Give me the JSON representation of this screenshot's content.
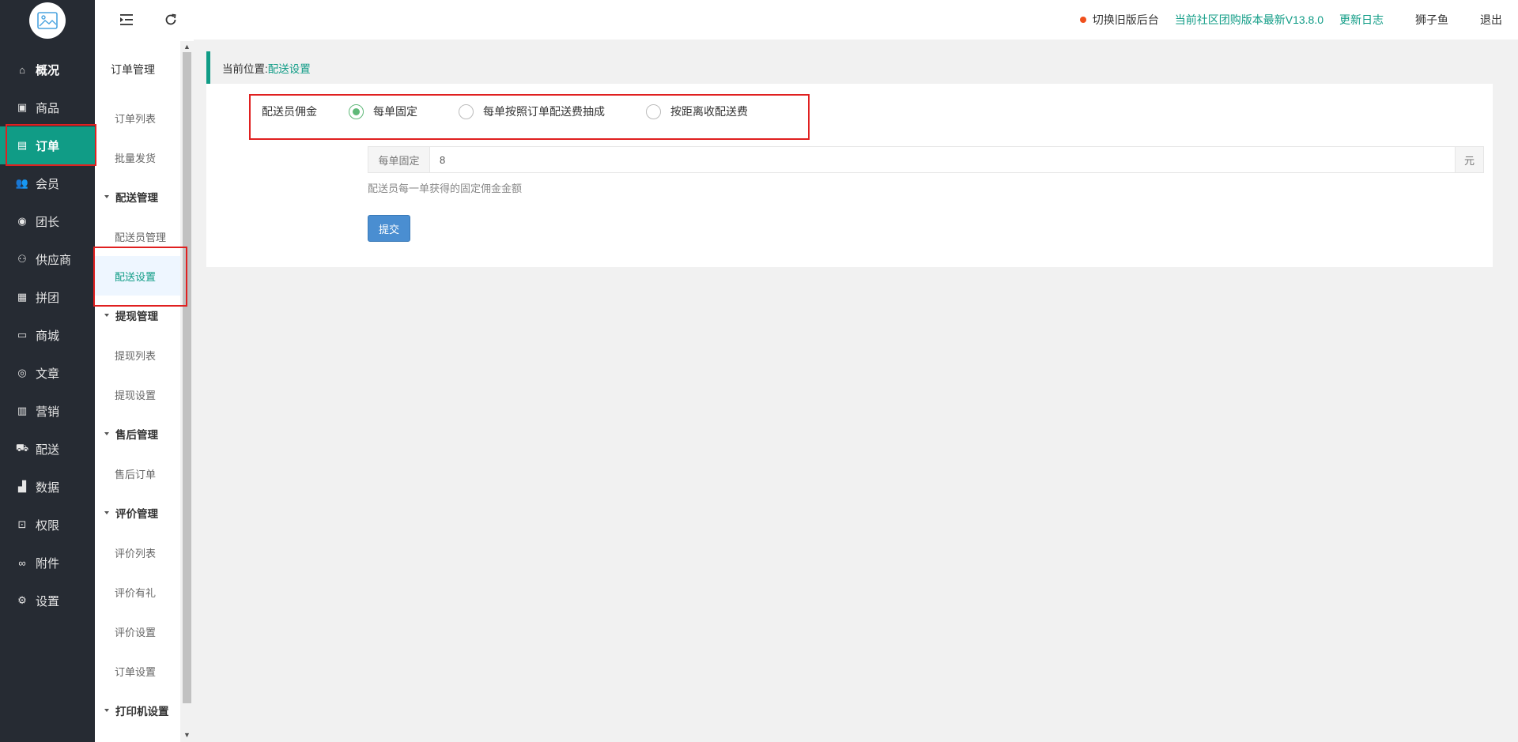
{
  "topbar": {
    "collapse_icon": "menu-fold-icon",
    "refresh_icon": "refresh-icon",
    "switch_old": "切换旧版后台",
    "version_text": "当前社区团购版本最新V13.8.0",
    "changelog": "更新日志",
    "username": "狮子鱼",
    "logout": "退出",
    "colors": {
      "accent": "#109c86",
      "dot": "#f0501c"
    }
  },
  "sidebar": {
    "items": [
      {
        "label": "概况",
        "icon": "home-icon"
      },
      {
        "label": "商品",
        "icon": "goods-icon"
      },
      {
        "label": "订单",
        "icon": "order-icon",
        "active": true
      },
      {
        "label": "会员",
        "icon": "members-icon"
      },
      {
        "label": "团长",
        "icon": "leader-icon"
      },
      {
        "label": "供应商",
        "icon": "supplier-icon"
      },
      {
        "label": "拼团",
        "icon": "group-buy-icon"
      },
      {
        "label": "商城",
        "icon": "store-icon"
      },
      {
        "label": "文章",
        "icon": "compass-icon"
      },
      {
        "label": "营销",
        "icon": "gift-icon"
      },
      {
        "label": "配送",
        "icon": "truck-icon"
      },
      {
        "label": "数据",
        "icon": "chart-icon"
      },
      {
        "label": "权限",
        "icon": "lock-icon"
      },
      {
        "label": "附件",
        "icon": "link-icon"
      },
      {
        "label": "设置",
        "icon": "gear-icon"
      }
    ]
  },
  "subnav": {
    "title": "订单管理",
    "items": [
      {
        "label": "订单列表",
        "type": "item"
      },
      {
        "label": "批量发货",
        "type": "item"
      },
      {
        "label": "配送管理",
        "type": "group"
      },
      {
        "label": "配送员管理",
        "type": "item"
      },
      {
        "label": "配送设置",
        "type": "item",
        "active": true
      },
      {
        "label": "提现管理",
        "type": "group"
      },
      {
        "label": "提现列表",
        "type": "item"
      },
      {
        "label": "提现设置",
        "type": "item"
      },
      {
        "label": "售后管理",
        "type": "group"
      },
      {
        "label": "售后订单",
        "type": "item"
      },
      {
        "label": "评价管理",
        "type": "group"
      },
      {
        "label": "评价列表",
        "type": "item"
      },
      {
        "label": "评价有礼",
        "type": "item"
      },
      {
        "label": "评价设置",
        "type": "item"
      },
      {
        "label": "订单设置",
        "type": "item"
      },
      {
        "label": "打印机设置",
        "type": "group"
      }
    ]
  },
  "breadcrumb": {
    "prefix": "当前位置:",
    "current": "配送设置"
  },
  "form": {
    "commission_label": "配送员佣金",
    "options": [
      {
        "label": "每单固定",
        "checked": true
      },
      {
        "label": "每单按照订单配送费抽成",
        "checked": false
      },
      {
        "label": "按距离收配送费",
        "checked": false
      }
    ],
    "fixed_addon": "每单固定",
    "fixed_value": "8",
    "unit": "元",
    "help": "配送员每一单获得的固定佣金金额",
    "submit": "提交"
  }
}
